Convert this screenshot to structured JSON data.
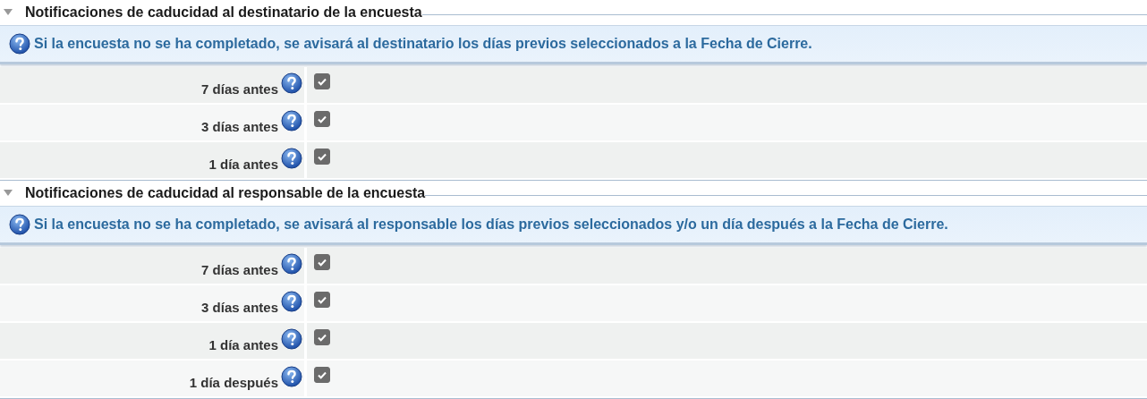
{
  "sections": [
    {
      "title": "Notificaciones de caducidad al destinatario de la encuesta",
      "expanded": true,
      "info": "Si la encuesta no se ha completado, se avisará al destinatario los días previos seleccionados a la Fecha de Cierre.",
      "rows": [
        {
          "label": "7 días antes",
          "checked": true
        },
        {
          "label": "3 días antes",
          "checked": true
        },
        {
          "label": "1 día antes",
          "checked": true
        }
      ]
    },
    {
      "title": "Notificaciones de caducidad al responsable de la encuesta",
      "expanded": true,
      "info": "Si la encuesta no se ha completado, se avisará al responsable los días previos seleccionados y/o un día después a la Fecha de Cierre.",
      "rows": [
        {
          "label": "7 días antes",
          "checked": true
        },
        {
          "label": "3 días antes",
          "checked": true
        },
        {
          "label": "1 día antes",
          "checked": true
        },
        {
          "label": "1 día después",
          "checked": true
        }
      ]
    }
  ]
}
